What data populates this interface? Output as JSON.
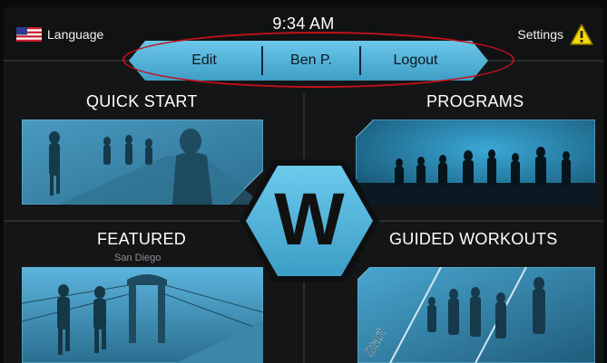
{
  "header": {
    "language_label": "Language",
    "time": "9:34 AM",
    "settings_label": "Settings"
  },
  "nav": {
    "edit_label": "Edit",
    "user_label": "Ben P.",
    "logout_label": "Logout"
  },
  "tiles": {
    "quick_start": {
      "title": "QUICK START"
    },
    "programs": {
      "title": "PROGRAMS"
    },
    "featured": {
      "title": "FEATURED",
      "subtitle": "San Diego"
    },
    "guided_workouts": {
      "title": "GUIDED WORKOUTS",
      "badge": "Start"
    }
  },
  "logo": {
    "letter": "W"
  },
  "colors": {
    "accent": "#4fb3dc",
    "pill": "#56b8df",
    "highlight_ring": "#c0121b",
    "background": "#141516",
    "warning": "#f5d90a"
  },
  "icons": [
    "us-flag-icon",
    "warning-icon"
  ]
}
